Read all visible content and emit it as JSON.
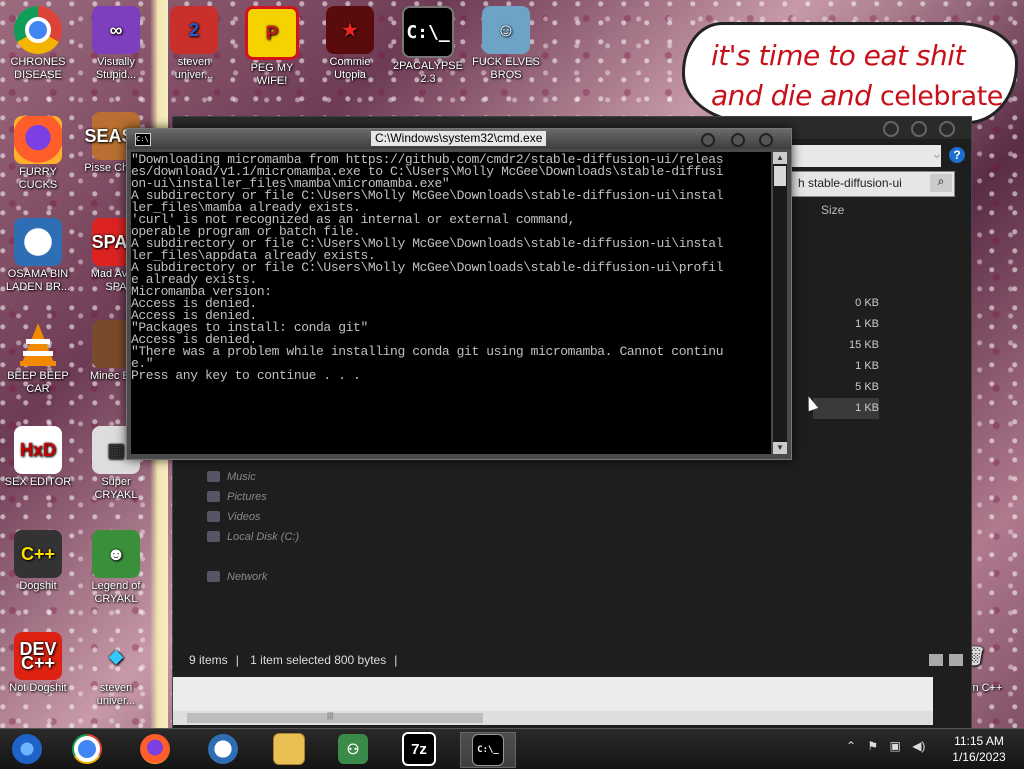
{
  "desktop": {
    "icons": [
      {
        "label": "CHRONES DISEASE",
        "icon": "chrome-icon"
      },
      {
        "label": "Visually Stupid...",
        "icon": "visual-studio-icon"
      },
      {
        "label": "steven univer...",
        "icon": "steven-universe-icon"
      },
      {
        "label": "PEG MY WIFE!",
        "icon": "peggle-icon"
      },
      {
        "label": "Commie Utopia",
        "icon": "commie-icon"
      },
      {
        "label": "2PACALYPSE 2.3",
        "icon": "cmd-icon"
      },
      {
        "label": "FUCK ELVES BROS",
        "icon": "elves-icon"
      },
      {
        "label": "FURRY CUCKS",
        "icon": "firefox-icon"
      },
      {
        "label": "Pisse Chicke",
        "icon": "seasons-icon"
      },
      {
        "label": "OSAMA BIN LADEN BR...",
        "icon": "obama-icon"
      },
      {
        "label": "Mad Av IN SPA",
        "icon": "angry-birds-icon"
      },
      {
        "label": "BEEP BEEP CAR",
        "icon": "vlc-icon"
      },
      {
        "label": "Minec Bird",
        "icon": "minecraft-icon"
      },
      {
        "label": "SEX EDITOR",
        "icon": "hxd-icon"
      },
      {
        "label": "Super CRYAKL",
        "icon": "cryakl-icon"
      },
      {
        "label": "Dogshit",
        "icon": "dogshit-icon"
      },
      {
        "label": "Legend of CRYAKL",
        "icon": "legend-icon"
      },
      {
        "label": "Not Dogshit",
        "icon": "devcpp-icon"
      },
      {
        "label": "steven univer...",
        "icon": "diamond-icon"
      },
      {
        "label": "Falcon C++",
        "icon": "trash-icon"
      }
    ],
    "bubble_line1": "it's time to eat shit",
    "bubble_line2a": "and die and ",
    "bubble_line2b": "celebrate"
  },
  "explorer": {
    "search_value": "h stable-diffusion-ui",
    "col_size": "Size",
    "sizes": [
      "0 KB",
      "1 KB",
      "15 KB",
      "1 KB",
      "5 KB",
      "1 KB"
    ],
    "nav": [
      "Music",
      "Pictures",
      "Videos",
      "Local Disk (C:)"
    ],
    "network": "Network",
    "status_items": "9 items",
    "status_selected": "1 item selected  800 bytes"
  },
  "cmd": {
    "title": "C:\\Windows\\system32\\cmd.exe",
    "output": "\"Downloading micromamba from https://github.com/cmdr2/stable-diffusion-ui/releas\nes/download/v1.1/micromamba.exe to C:\\Users\\Molly McGee\\Downloads\\stable-diffusi\non-ui\\installer_files\\mamba\\micromamba.exe\"\nA subdirectory or file C:\\Users\\Molly McGee\\Downloads\\stable-diffusion-ui\\instal\nler_files\\mamba already exists.\n'curl' is not recognized as an internal or external command,\noperable program or batch file.\nA subdirectory or file C:\\Users\\Molly McGee\\Downloads\\stable-diffusion-ui\\instal\nler_files\\appdata already exists.\nA subdirectory or file C:\\Users\\Molly McGee\\Downloads\\stable-diffusion-ui\\profil\ne already exists.\nMicromamba version:\nAccess is denied.\nAccess is denied.\n\"Packages to install: conda git\"\nAccess is denied.\n\"There was a problem while installing conda git using micromamba. Cannot continu\ne.\"\nPress any key to continue . . ."
  },
  "taskbar": {
    "items": [
      "windows-start-icon",
      "chrome-icon",
      "firefox-icon",
      "obama-icon",
      "file-explorer-icon",
      "network-people-icon",
      "7zip-icon",
      "cmd-icon"
    ],
    "sevenzip_label": "7z",
    "time": "11:15 AM",
    "date": "1/16/2023"
  },
  "colors": {
    "bubble_text": "#c8101a",
    "taskbar": "#1c1c1c",
    "cmd_bg": "#000000"
  }
}
